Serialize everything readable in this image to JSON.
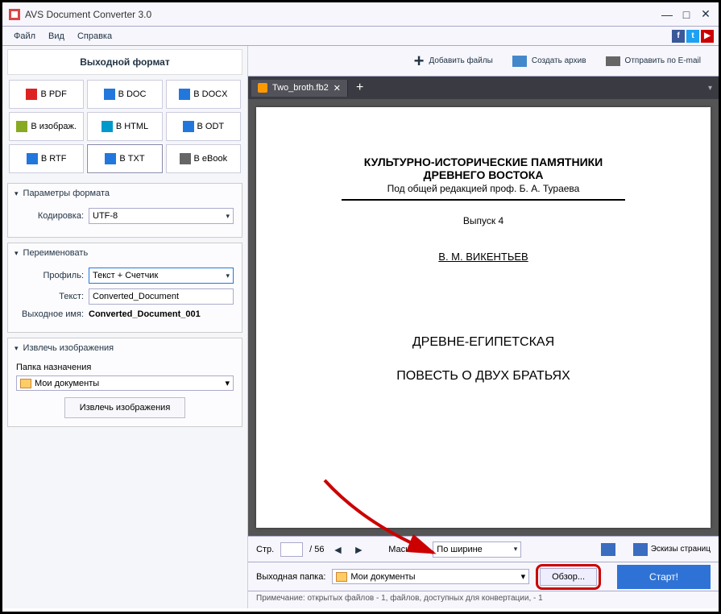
{
  "window": {
    "title": "AVS Document Converter 3.0"
  },
  "menu": {
    "file": "Файл",
    "view": "Вид",
    "help": "Справка"
  },
  "toolbar": {
    "add_files": "Добавить файлы",
    "create_archive": "Создать архив",
    "send_email": "Отправить по E-mail"
  },
  "left": {
    "output_format_header": "Выходной формат",
    "formats": {
      "pdf": "В PDF",
      "doc": "В DOC",
      "docx": "В DOCX",
      "img": "В изображ.",
      "html": "В HTML",
      "odt": "В ODT",
      "rtf": "В RTF",
      "txt": "В TXT",
      "ebook": "В eBook"
    },
    "params_header": "Параметры формата",
    "encoding_label": "Кодировка:",
    "encoding_value": "UTF-8",
    "rename_header": "Переименовать",
    "profile_label": "Профиль:",
    "profile_value": "Текст + Счетчик",
    "text_label": "Текст:",
    "text_value": "Converted_Document",
    "outname_label": "Выходное имя:",
    "outname_value": "Converted_Document_001",
    "extract_header": "Извлечь изображения",
    "dest_folder_label": "Папка назначения",
    "dest_folder_value": "Мои документы",
    "extract_button": "Извлечь изображения"
  },
  "tabs": {
    "file1": "Two_broth.fb2"
  },
  "preview": {
    "line1": "КУЛЬТУРНО-ИСТОРИЧЕСКИЕ ПАМЯТНИКИ",
    "line2": "ДРЕВНЕГО ВОСТОКА",
    "line3": "Под общей редакцией проф. Б. А. Тураева",
    "issue": "Выпуск 4",
    "author": "В. М. ВИКЕНТЬЕВ",
    "head1": "ДРЕВНЕ-ЕГИПЕТСКАЯ",
    "head2": "ПОВЕСТЬ О ДВУХ БРАТЬЯХ"
  },
  "preview_controls": {
    "page_label": "Стр.",
    "page_current": "",
    "page_total": "/ 56",
    "zoom_label": "Масштаб",
    "zoom_value": "По ширине",
    "thumbs_label": "Эскизы страниц"
  },
  "output": {
    "label": "Выходная папка:",
    "folder": "Мои документы",
    "browse": "Обзор...",
    "start": "Старт!"
  },
  "note": "Примечание: открытых файлов - 1, файлов, доступных для конвертации, - 1"
}
